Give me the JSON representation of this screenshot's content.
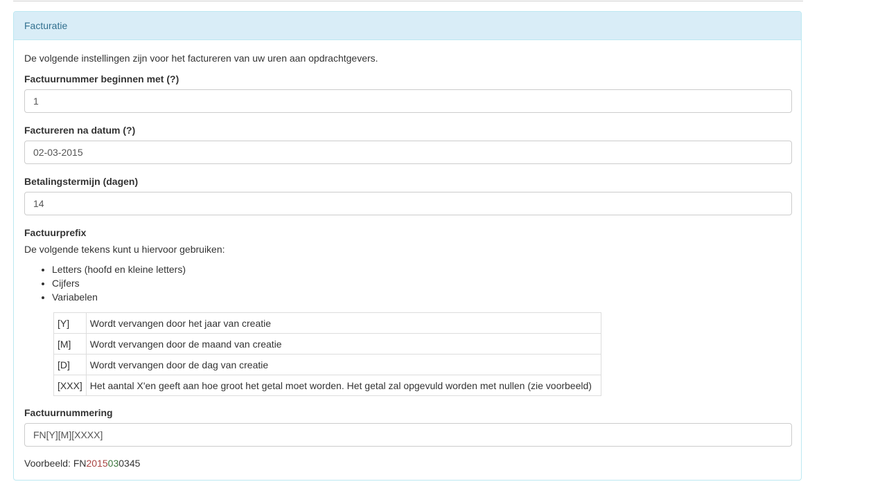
{
  "panel": {
    "title": "Facturatie",
    "intro": "De volgende instellingen zijn voor het factureren van uw uren aan opdrachtgevers."
  },
  "fields": {
    "invoice_start": {
      "label": "Factuurnummer beginnen met (?)",
      "value": "1"
    },
    "invoice_after_date": {
      "label": "Factureren na datum (?)",
      "value": "02-03-2015"
    },
    "payment_term": {
      "label": "Betalingstermijn (dagen)",
      "value": "14"
    }
  },
  "prefix": {
    "heading": "Factuurprefix",
    "description": "De volgende tekens kunt u hiervoor gebruiken:",
    "bullets": [
      "Letters (hoofd en kleine letters)",
      "Cijfers",
      "Variabelen"
    ],
    "variables": [
      {
        "code": "[Y]",
        "description": "Wordt vervangen door het jaar van creatie"
      },
      {
        "code": "[M]",
        "description": "Wordt vervangen door de maand van creatie"
      },
      {
        "code": "[D]",
        "description": "Wordt vervangen door de dag van creatie"
      },
      {
        "code": "[XXX]",
        "description": "Het aantal X'en geeft aan hoe groot het getal moet worden. Het getal zal opgevuld worden met nullen (zie voorbeeld)"
      }
    ]
  },
  "numbering": {
    "label": "Factuurnummering",
    "value": "FN[Y][M][XXXX]"
  },
  "example": {
    "label": "Voorbeeld: ",
    "part_prefix": "FN",
    "part_year": "2015",
    "part_month": "03",
    "part_number": "0345",
    "colors": {
      "year": "#a94442",
      "month": "#3c763d"
    }
  }
}
